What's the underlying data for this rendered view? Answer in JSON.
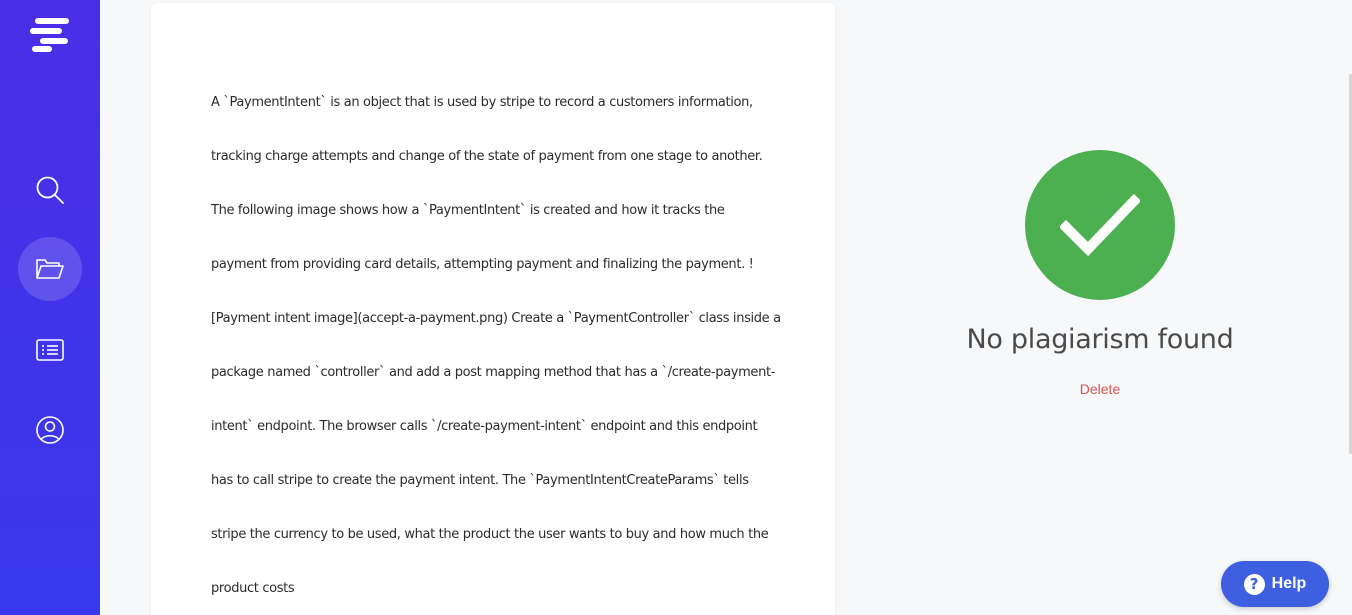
{
  "sidebar": {
    "logo_icon": "menu-lines-logo",
    "items": [
      {
        "name": "search",
        "icon": "search-icon",
        "active": false
      },
      {
        "name": "folder",
        "icon": "folder-open-icon",
        "active": true
      },
      {
        "name": "list",
        "icon": "list-icon",
        "active": false
      },
      {
        "name": "profile",
        "icon": "user-circle-icon",
        "active": false
      }
    ]
  },
  "document": {
    "text": "A `PaymentIntent` is an object that is used by stripe to record a customers information, tracking charge attempts and change of the state of payment from one stage to another. The following image shows how a `PaymentIntent` is created and how it tracks the payment from providing card details, attempting payment and finalizing the payment. ![Payment intent image](accept-a-payment.png) Create a `PaymentController` class inside a package named `controller` and add a post mapping method that has a `/create-payment-intent` endpoint. The browser calls `/create-payment-intent` endpoint and this endpoint has to call stripe to create the payment intent. The `PaymentIntentCreateParams` tells stripe the currency to be used, what the product the user wants to buy and how much the product costs"
  },
  "result": {
    "status_icon": "check-circle-icon",
    "title": "No plagiarism found",
    "delete_label": "Delete"
  },
  "help": {
    "label": "Help",
    "icon_glyph": "?"
  },
  "colors": {
    "sidebar": "#4130ea",
    "success": "#4caf50",
    "delete": "#d9534f",
    "help_button": "#3d5fe0"
  }
}
